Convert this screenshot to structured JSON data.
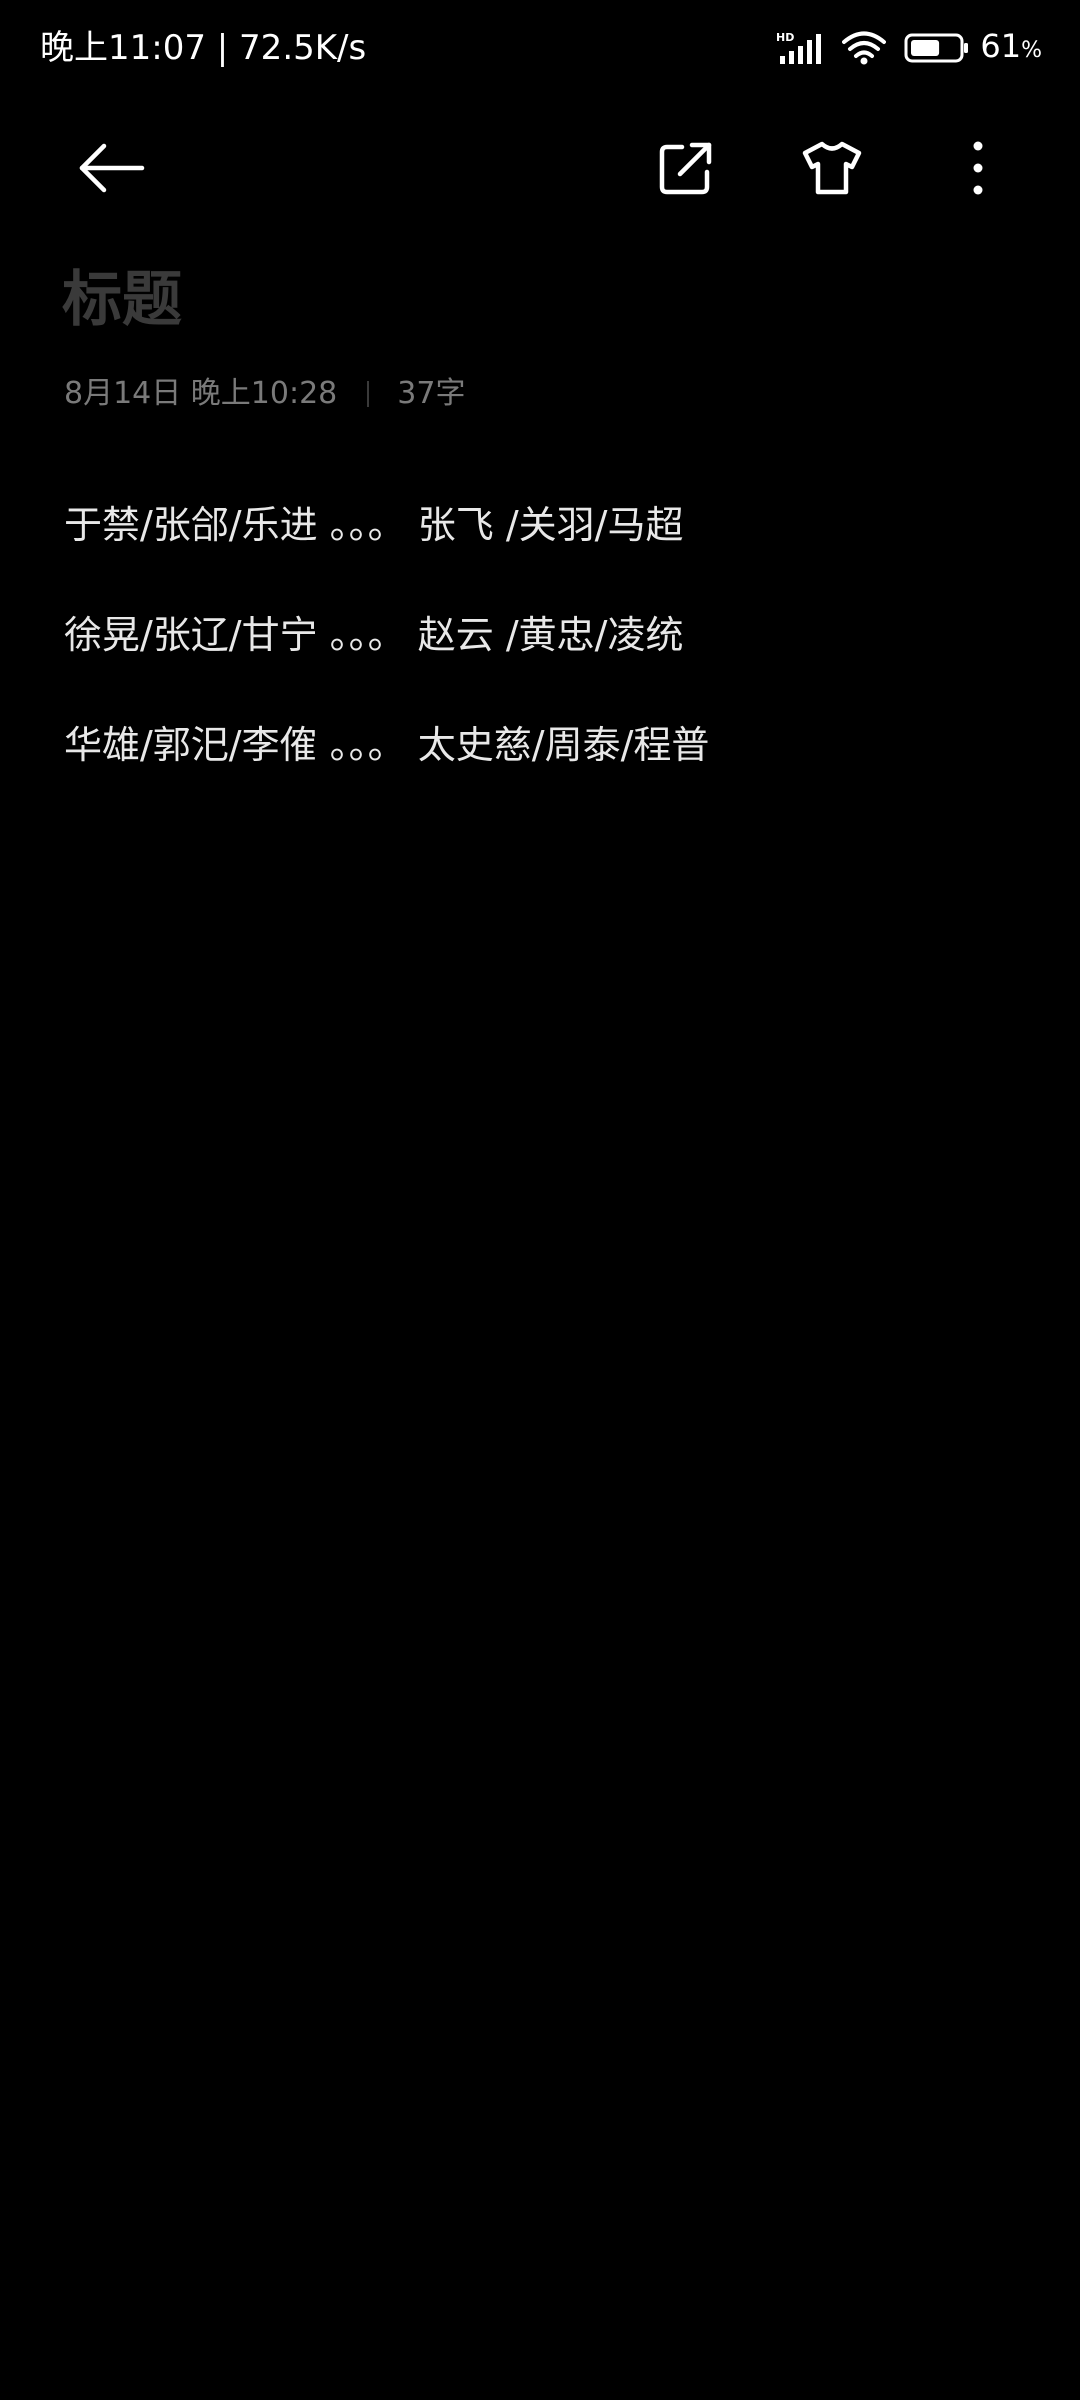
{
  "status_bar": {
    "time_speed": "晚上11:07 | 72.5K/s",
    "hd_label": "HD",
    "battery_level": 0.61,
    "battery_number": "61",
    "battery_unit": "%",
    "icons": [
      "signal-icon",
      "wifi-icon",
      "battery-icon"
    ]
  },
  "toolbar": {
    "icons": [
      "back-arrow-icon",
      "share-icon",
      "tshirt-theme-icon",
      "more-vert-icon"
    ]
  },
  "note": {
    "title": "标题",
    "date": "8月14日  晚上10:28",
    "char_count": "37字",
    "lines": [
      "于禁/张郃/乐进 。。。 张飞 /关羽/马超",
      "徐晃/张辽/甘宁 。。。 赵云 /黄忠/凌统",
      "华雄/郭汜/李傕 。。。 太史慈/周泰/程普"
    ]
  },
  "colors": {
    "background": "#000000",
    "text": "#e8e8e8",
    "title_placeholder": "#3a3a3a",
    "meta": "#7a7a7a"
  }
}
